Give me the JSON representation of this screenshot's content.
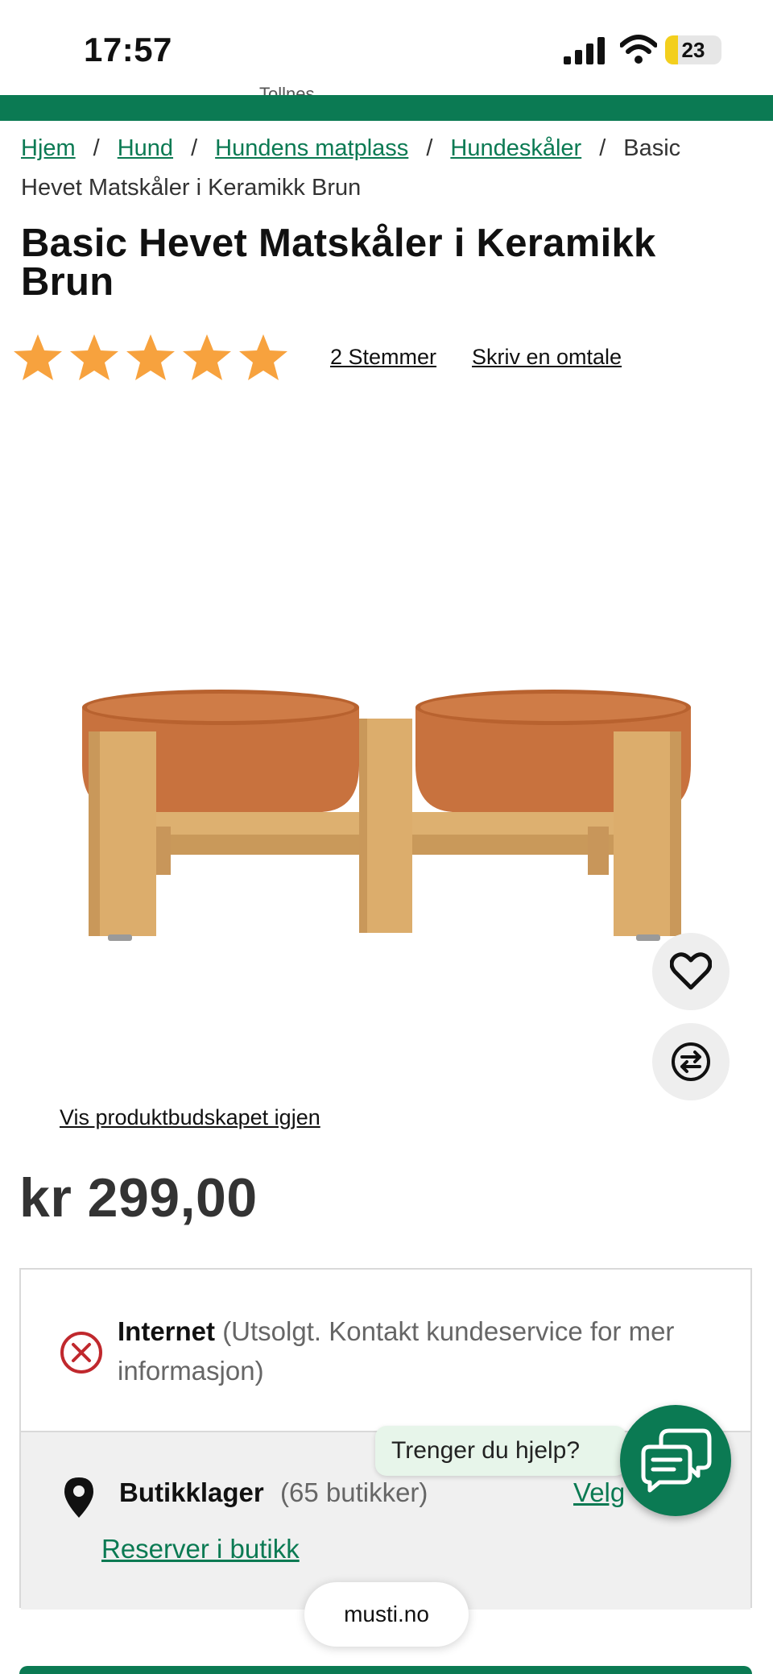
{
  "status_bar": {
    "time": "17:57",
    "battery": "23",
    "battery_level": 0.23
  },
  "header": {
    "ghost_text": "Tollnes"
  },
  "breadcrumb": {
    "links": [
      "Hjem",
      "Hund",
      "Hundens matplass",
      "Hundeskåler"
    ],
    "separator": "/",
    "current": "Basic Hevet Matskåler i Keramikk Brun"
  },
  "product": {
    "title": "Basic Hevet Matskåler i Keramikk Brun",
    "rating": {
      "stars": 5,
      "max_stars": 5,
      "votes_label": "2 Stemmer",
      "write_review_label": "Skriv en omtale"
    },
    "show_message_label": "Vis produktbudskapet igjen",
    "price": "kr 299,00"
  },
  "availability": {
    "online_label": "Internet",
    "online_status": "(Utsolgt. Kontakt kundeservice for mer informasjon)",
    "store_label": "Butikklager",
    "store_count": "(65 butikker)",
    "select_store_label": "Velg",
    "reserve_label": "Reserver i butikk"
  },
  "help": {
    "bubble_text": "Trenger du hjelp?"
  },
  "browser": {
    "domain": "musti.no"
  },
  "colors": {
    "brand_green": "#0b7a53",
    "star": "#f7a23e",
    "bowl": "#c8723e",
    "wood": "#d9aa68"
  }
}
